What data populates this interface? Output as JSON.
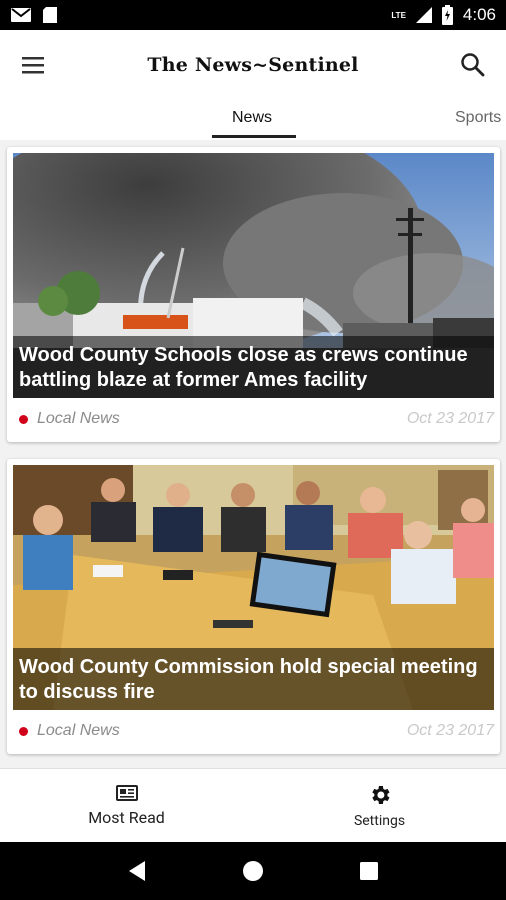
{
  "status_bar": {
    "time": "4:06",
    "network": "LTE"
  },
  "app": {
    "masthead": "The News~Sentinel"
  },
  "tabs": [
    {
      "label": "News",
      "selected": true
    },
    {
      "label": "Sports",
      "selected": false
    }
  ],
  "articles": [
    {
      "headline": "Wood County Schools close as crews continue battling blaze at former Ames facility",
      "category": "Local News",
      "date": "Oct 23 2017",
      "image": "smoke-fire-scene"
    },
    {
      "headline": "Wood County Commission hold special meeting to discuss fire",
      "category": "Local News",
      "date": "Oct 23 2017",
      "image": "commission-meeting"
    }
  ],
  "bottom_nav": {
    "most_read_label": "Most Read",
    "settings_label": "Settings"
  },
  "colors": {
    "accent_dot": "#d0021b",
    "tab_indicator": "#222222"
  }
}
